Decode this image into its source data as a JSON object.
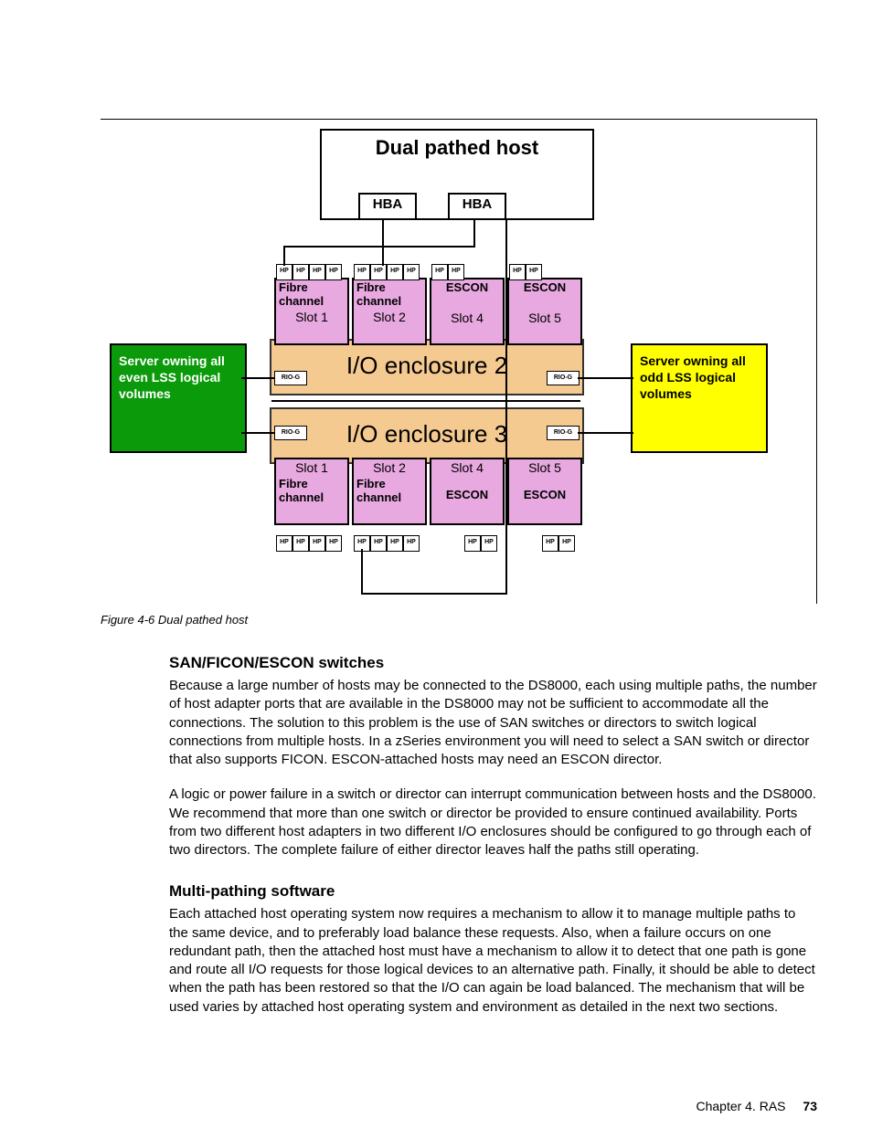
{
  "diagram": {
    "host_title": "Dual pathed host",
    "hba": "HBA",
    "hp": "HP",
    "rio": "RIO-G",
    "enclosure2": "I/O enclosure 2",
    "enclosure3": "I/O enclosure 3",
    "slots_top": [
      {
        "type": "Fibre channel",
        "slot": "Slot 1"
      },
      {
        "type": "Fibre channel",
        "slot": "Slot 2"
      },
      {
        "type": "ESCON",
        "slot": "Slot 4"
      },
      {
        "type": "ESCON",
        "slot": "Slot 5"
      }
    ],
    "slots_bottom": [
      {
        "slot": "Slot 1",
        "type": "Fibre channel"
      },
      {
        "slot": "Slot 2",
        "type": "Fibre channel"
      },
      {
        "slot": "Slot 4",
        "type": "ESCON"
      },
      {
        "slot": "Slot 5",
        "type": "ESCON"
      }
    ],
    "server_even": "Server owning all even LSS logical volumes",
    "server_odd": "Server owning all odd LSS logical volumes"
  },
  "figure_caption": "Figure 4-6   Dual pathed host",
  "section1_title": "SAN/FICON/ESCON switches",
  "section1_p1": "Because a large number of hosts may be connected to the DS8000, each using multiple paths, the number of host adapter ports that are available in the DS8000 may not be sufficient to accommodate all the connections. The solution to this problem is the use of SAN switches or directors to switch logical connections from multiple hosts. In a zSeries environment you will need to select a SAN switch or director that also supports FICON. ESCON-attached hosts may need an ESCON director.",
  "section1_p2": "A logic or power failure in a switch or director can interrupt communication between hosts and the DS8000. We recommend that more than one switch or director be provided to ensure continued availability. Ports from two different host adapters in two different I/O enclosures should be configured to go through each of two directors. The complete failure of either director leaves half the paths still operating.",
  "section2_title": "Multi-pathing software",
  "section2_p1": "Each attached host operating system now requires a mechanism to allow it to manage multiple paths to the same device, and to preferably load balance these requests. Also, when a failure occurs on one redundant path, then the attached host must have a mechanism to allow it to detect that one path is gone and route all I/O requests for those logical devices to an alternative path. Finally, it should be able to detect when the path has been restored so that the I/O can again be load balanced. The mechanism that will be used varies by attached host operating system and environment as detailed in the next two sections.",
  "footer_chapter": "Chapter 4. RAS",
  "footer_page": "73"
}
